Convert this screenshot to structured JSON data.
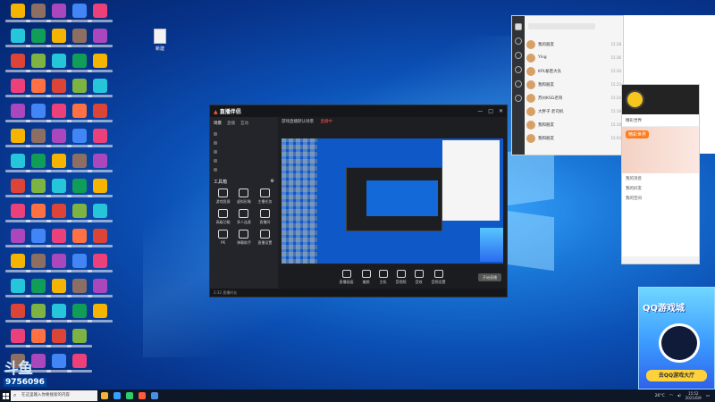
{
  "desktop": {
    "file_label": "新建",
    "stream_logo": "斗鱼",
    "stream_number": "9756096"
  },
  "app": {
    "brand": "直播伴侣",
    "side_tabs": [
      "场景",
      "直播",
      "互动"
    ],
    "tools_title": "工具箱",
    "tools": [
      "游戏投屏",
      "虚拟形象",
      "主播任务",
      "高级功能",
      "多人连麦",
      "直播间",
      "PK",
      "弹幕助手",
      "直播设置"
    ],
    "scene_title": "游戏直播默认场景",
    "scene_live_tag": "直播中",
    "bottom_buttons": [
      "直播画面",
      "美颜",
      "主机",
      "音视频",
      "音效",
      "音频设置"
    ],
    "start_live": "开始直播",
    "status_text": "2:32 直播时长"
  },
  "chat": {
    "items": [
      {
        "name": "我的朋友",
        "time": "15:38"
      },
      {
        "name": "Ying",
        "time": "15:36"
      },
      {
        "name": "KPL秘密大队",
        "time": "15:30"
      },
      {
        "name": "我和朋友",
        "time": "15:22"
      },
      {
        "name": "苏州KSG老哥",
        "time": "15:20"
      },
      {
        "name": "大胖子.老司机",
        "time": "15:18"
      },
      {
        "name": "我和朋友",
        "time": "15:10"
      },
      {
        "name": "我和朋友",
        "time": "15:02"
      }
    ]
  },
  "game": {
    "tab_label": "精彩世界",
    "banner": "精彩世界",
    "lines": [
      "我的消息",
      "我的好友",
      "我的空间"
    ]
  },
  "ad": {
    "headline": "QQ游戏城",
    "cta": "去QQ游戏大厅"
  },
  "taskbar": {
    "search_placeholder": "在这里输入你要搜索的内容",
    "temperature": "26°C",
    "time": "15:52",
    "date": "2021/6/9"
  },
  "colors": {
    "accent": "#ff5a3c",
    "taskbar": "#0e1726",
    "wallpaper": "#0b4fb4"
  }
}
